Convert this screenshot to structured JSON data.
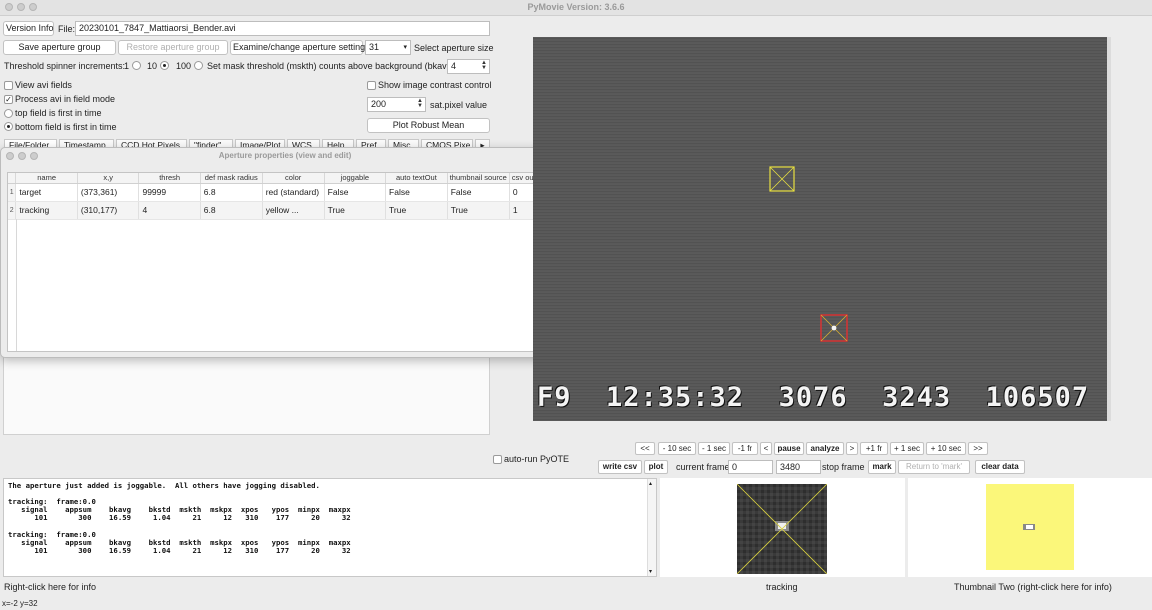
{
  "window": {
    "title": "PyMovie  Version: 3.6.6"
  },
  "toolbar": {
    "version_info": "Version Info",
    "file_label": "File:",
    "file_value": "20230101_7847_Mattiaorsi_Bender.avi",
    "save_aperture_group": "Save aperture group",
    "restore_aperture_group": "Restore aperture group",
    "examine_aperture_settings": "Examine/change aperture settings",
    "aperture_size_value": "31",
    "select_aperture_size": "Select aperture size"
  },
  "threshold": {
    "label": "Threshold spinner increments:",
    "options": [
      "1",
      "10",
      "100"
    ],
    "selected": "10",
    "mask_label": "Set mask threshold (mskth) counts above background (bkavg)",
    "mask_value": "4"
  },
  "options": {
    "view_avi_fields": "View avi fields",
    "process_field_mode": "Process avi in field mode",
    "top_field_first": "top field is first in time",
    "bottom_field_first": "bottom field is first in time",
    "show_contrast": "Show image contrast control",
    "sat_value": "200",
    "sat_label": "sat.pixel value",
    "plot_robust_mean": "Plot Robust Mean"
  },
  "tabs": [
    "File/Folder",
    "Timestamp",
    "CCD Hot Pixels",
    "\"finder\"",
    "Image/Plot",
    "WCS",
    "Help",
    "Pref",
    "Misc",
    "CMOS Pixe"
  ],
  "aperture_window": {
    "title": "Aperture properties (view and edit)",
    "columns": [
      "name",
      "x,y",
      "thresh",
      "def mask radius",
      "color",
      "joggable",
      "auto textOut",
      "thumbnail source",
      "csv output ord"
    ],
    "rows": [
      {
        "num": "1",
        "cells": [
          "target",
          "(373,361)",
          "99999",
          "6.8",
          "red (standard)",
          "False",
          "False",
          "False",
          "0"
        ]
      },
      {
        "num": "2",
        "cells": [
          "tracking",
          "(310,177)",
          "4",
          "6.8",
          "yellow ...",
          "True",
          "True",
          "True",
          "1"
        ]
      }
    ]
  },
  "video": {
    "osd_text": "F9  12:35:32  3076  3243  106507"
  },
  "navigation": {
    "auto_run_pyote": "auto-run PyOTE",
    "buttons": [
      "<<",
      "- 10 sec",
      "- 1 sec",
      "-1 fr",
      "<",
      "pause",
      "analyze",
      ">",
      "+1 fr",
      "+ 1 sec",
      "+ 10 sec",
      ">>"
    ],
    "write_csv": "write csv",
    "plot": "plot",
    "current_frame_label": "current frame",
    "current_frame_value": "0",
    "stop_frame_value": "3480",
    "stop_frame_label": "stop frame",
    "mark": "mark",
    "return_to_mark": "Return to 'mark'",
    "clear_data": "clear data"
  },
  "log": {
    "text": "The aperture just added is joggable.  All others have jogging disabled.\n\ntracking:  frame:0.0\n   signal    appsum    bkavg    bkstd  mskth  mskpx  xpos   ypos  minpx  maxpx\n      101       300    16.59     1.04     21     12   310    177     20     32\n\ntracking:  frame:0.0\n   signal    appsum    bkavg    bkstd  mskth  mskpx  xpos   ypos  minpx  maxpx\n      101       300    16.59     1.04     21     12   310    177     20     32"
  },
  "thumbnails": {
    "one_label": "tracking",
    "two_label": "Thumbnail Two (right-click here for info)"
  },
  "status": {
    "right_click_info": "Right-click here for info",
    "coords": "x=-2 y=32"
  },
  "colors": {
    "target": "#e03030",
    "tracking": "#e8e040",
    "thumb_two_bg": "#fbf77a"
  }
}
